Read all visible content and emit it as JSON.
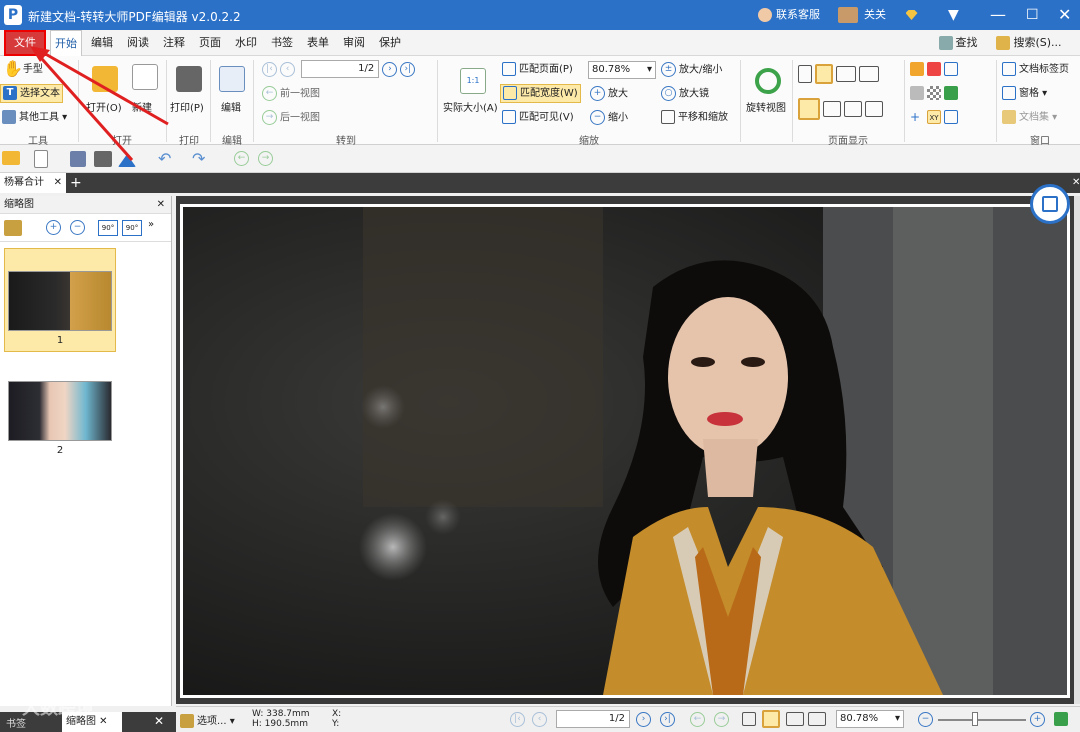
{
  "window": {
    "title": "新建文档-转转大师PDF编辑器 v2.0.2.2",
    "logo": "P",
    "customer_service": "联系客服",
    "user_name": "关关"
  },
  "menu": [
    "文件",
    "开始",
    "编辑",
    "阅读",
    "注释",
    "页面",
    "水印",
    "书签",
    "表单",
    "审阅",
    "保护"
  ],
  "menu_right": {
    "find": "查找(F)...",
    "search": "搜索(S)..."
  },
  "ribbon": {
    "tools": {
      "hand": "手型",
      "select_text": "选择文本",
      "other_tools": "其他工具",
      "label": "工具"
    },
    "open": {
      "open": "打开(O)",
      "new": "新建",
      "label": "打开"
    },
    "print": {
      "print": "打印(P)",
      "label": "打印"
    },
    "edit": {
      "edit": "编辑",
      "label": "编辑"
    },
    "goto": {
      "page_value": "1",
      "page_total": "/2",
      "prev_view": "前一视图",
      "next_view": "后一视图",
      "label": "转到"
    },
    "zoom": {
      "actual_size": "实际大小(A)",
      "fit_page": "匹配页面(P)",
      "fit_width": "匹配宽度(W)",
      "fit_visible": "匹配可见(V)",
      "zoom_value": "80.78%",
      "zoom_inout": "放大/缩小",
      "zoom_in": "放大",
      "zoom_out": "缩小",
      "magnifier": "放大镜",
      "pan_zoom": "平移和缩放",
      "label": "缩放"
    },
    "rotate": {
      "rotate": "旋转视图"
    },
    "page_display": {
      "label": "页面显示"
    },
    "window_grp": {
      "doc_tab": "文档标签页",
      "window": "窗格",
      "doc_set": "文档集",
      "label": "窗口"
    }
  },
  "doc_tab": {
    "name": "杨幂合计"
  },
  "sidebar": {
    "title": "缩略图",
    "rot_left": "90°",
    "rot_right": "90°",
    "thumbnails": [
      {
        "num": "1"
      },
      {
        "num": "2"
      }
    ]
  },
  "status": {
    "options": "选项...",
    "width": "W: 338.7mm",
    "height": "H: 190.5mm",
    "x": "X:",
    "y": "Y:",
    "page_value": "1",
    "page_total": "/2",
    "zoom_value": "80.78%"
  },
  "bottom_tabs": [
    "书签",
    "缩略图"
  ],
  "watermark": "大数跨境",
  "colors": {
    "titlebar": "#2b71c8",
    "file_menu": "#d63a3a",
    "arrow": "#e02020",
    "selected": "#fde9a8"
  }
}
